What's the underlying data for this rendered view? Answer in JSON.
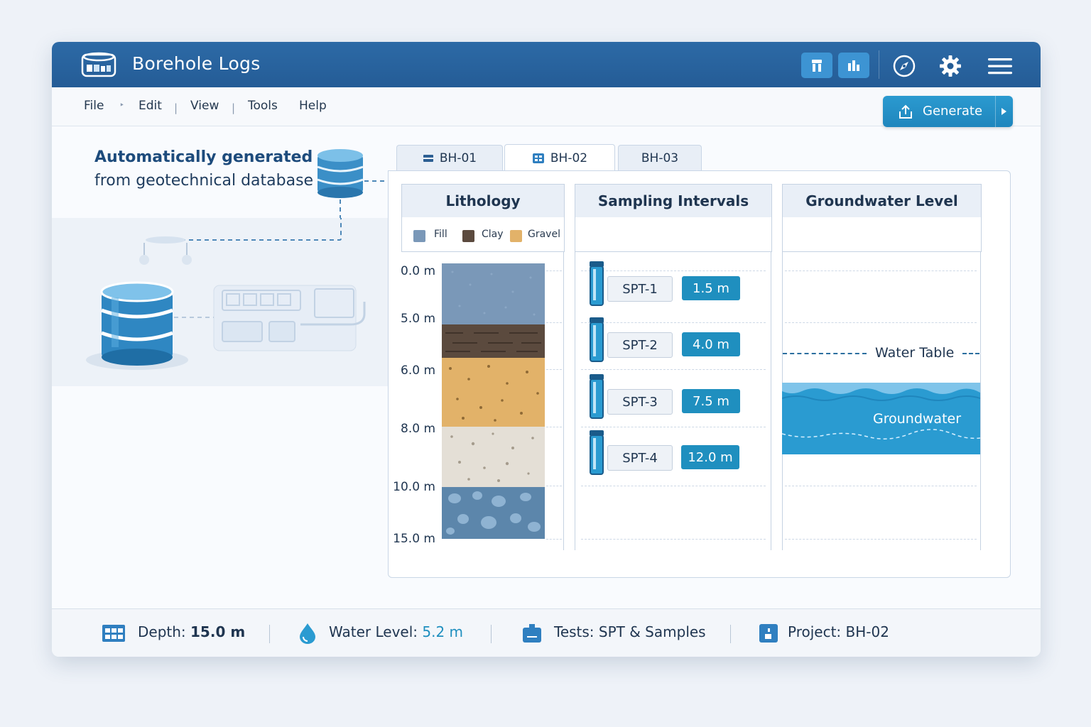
{
  "app": {
    "title": "Borehole Logs"
  },
  "menu": {
    "items": [
      "File",
      "Edit",
      "View",
      "Tools",
      "Help"
    ],
    "separators": [
      "‣",
      "|",
      "|"
    ]
  },
  "toolbar": {
    "generate_label": "Generate",
    "accent": "#1f86bd"
  },
  "tagline": {
    "line1": "Automatically generated",
    "line2": "from geotechnical database"
  },
  "tabs": [
    {
      "label": "BH-01",
      "icon": "log-icon"
    },
    {
      "label": "BH-02",
      "icon": "grid-icon",
      "active": true
    },
    {
      "label": "BH-03"
    }
  ],
  "columns": {
    "lithology": "Lithology",
    "sampling": "Sampling Intervals",
    "groundwater": "Groundwater Level"
  },
  "legend": [
    {
      "label": "Fill",
      "color": "#7a98b8"
    },
    {
      "label": "Clay",
      "color": "#5b4a3e"
    },
    {
      "label": "Gravel",
      "color": "#e2b269"
    }
  ],
  "depths": [
    "0.0 m",
    "5.0 m",
    "6.0 m",
    "8.0 m",
    "10.0 m",
    "15.0 m"
  ],
  "samples": [
    {
      "label": "SPT-1",
      "depth": "1.5 m"
    },
    {
      "label": "SPT-2",
      "depth": "4.0 m"
    },
    {
      "label": "SPT-3",
      "depth": "7.5 m"
    },
    {
      "label": "SPT-4",
      "depth": "12.0 m"
    }
  ],
  "groundwater": {
    "water_table_label": "Water Table",
    "groundwater_label": "Groundwater",
    "color": "#2a9bd1"
  },
  "status": {
    "depth_label": "Depth:",
    "depth_value": "15.0 m",
    "water_label": "Water Level:",
    "water_value": "5.2 m",
    "tests_label": "Tests: SPT & Samples",
    "project_label": "Project: BH-02"
  }
}
